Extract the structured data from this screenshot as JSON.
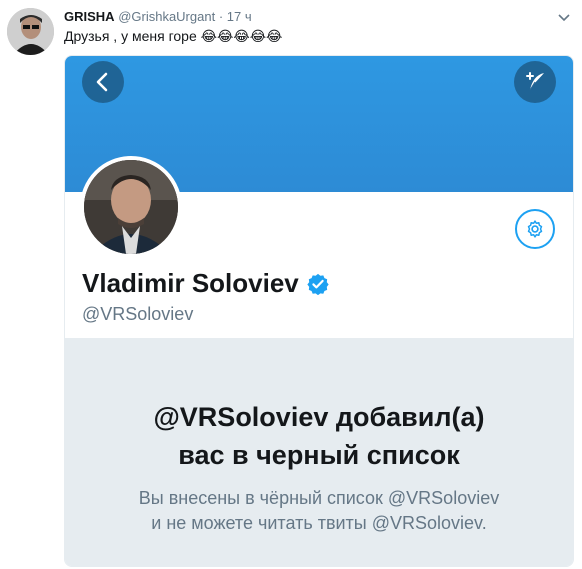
{
  "tweet": {
    "author_name": "GRISHA",
    "author_handle": "@GrishkaUrgant",
    "separator": "·",
    "time": "17 ч",
    "text": "Друзья , у меня горе",
    "emojis": "😂😂😂😂😂"
  },
  "embedded": {
    "profile_name": "Vladimir Soloviev",
    "profile_handle": "@VRSoloviev",
    "blocked_title_line1": "@VRSoloviev добавил(а)",
    "blocked_title_line2": "вас в черный список",
    "blocked_sub_line1": "Вы внесены в чёрный список @VRSoloviev",
    "blocked_sub_line2": "и не можете читать твиты @VRSoloviev.",
    "colors": {
      "banner": "#2e98e2",
      "accent": "#1da1f2",
      "blocked_bg": "#e6ecf0",
      "muted_text": "#657786"
    }
  },
  "icons": {
    "caret": "chevron-down-icon",
    "back": "back-arrow-icon",
    "compose": "compose-feather-icon",
    "settings": "gear-icon",
    "verified": "verified-badge-icon"
  }
}
